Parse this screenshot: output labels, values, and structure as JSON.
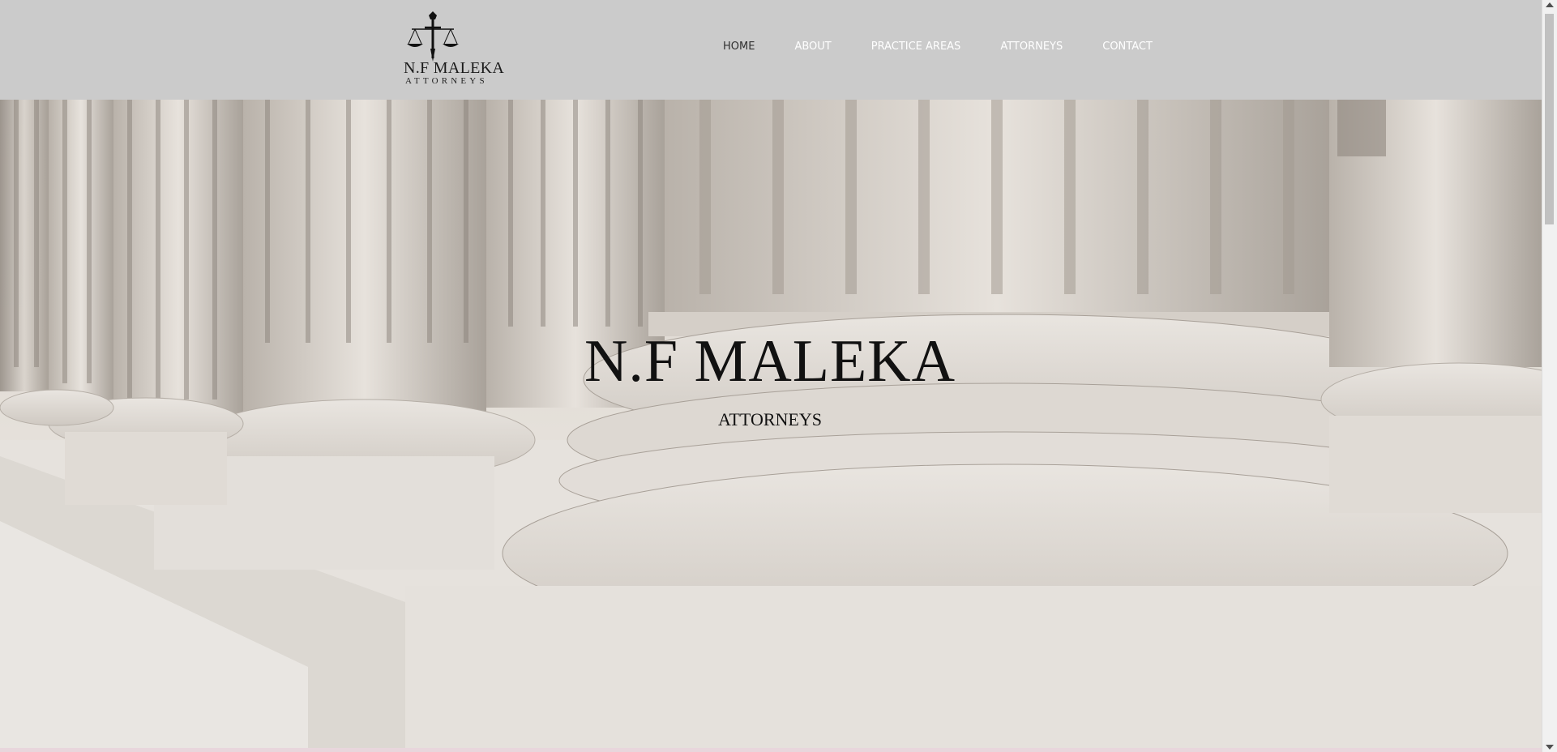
{
  "logo": {
    "name": "N.F MALEKA",
    "subtitle": "ATTORNEYS",
    "icon": "scales-of-justice-sword-icon"
  },
  "nav": {
    "items": [
      {
        "label": "HOME",
        "active": true
      },
      {
        "label": "ABOUT",
        "active": false
      },
      {
        "label": "PRACTICE AREAS",
        "active": false
      },
      {
        "label": "ATTORNEYS",
        "active": false
      },
      {
        "label": "CONTACT",
        "active": false
      }
    ]
  },
  "hero": {
    "title": "N.F MALEKA",
    "subtitle": "ATTORNEYS",
    "background": "marble-columns-image"
  },
  "colors": {
    "header_bg": "#cbcbcb",
    "nav_text": "#ffffff",
    "nav_active": "#2f2f2f",
    "title_text": "#111111"
  }
}
